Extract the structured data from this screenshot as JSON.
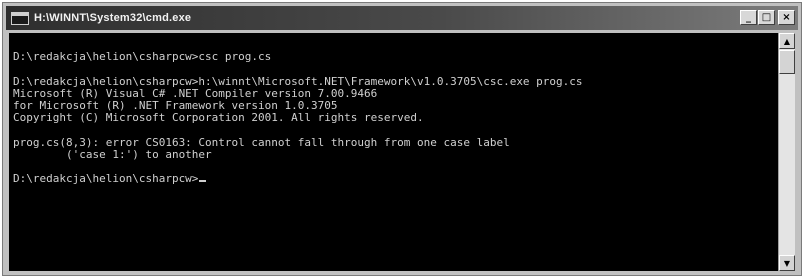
{
  "window": {
    "title": "H:\\WINNT\\System32\\cmd.exe",
    "icon": "console-window-icon",
    "buttons": {
      "minimize": "_",
      "maximize": "□",
      "close": "×"
    }
  },
  "console": {
    "lines": [
      "",
      "D:\\redakcja\\helion\\csharpcw>csc prog.cs",
      "",
      "D:\\redakcja\\helion\\csharpcw>h:\\winnt\\Microsoft.NET\\Framework\\v1.0.3705\\csc.exe prog.cs",
      "Microsoft (R) Visual C# .NET Compiler version 7.00.9466",
      "for Microsoft (R) .NET Framework version 1.0.3705",
      "Copyright (C) Microsoft Corporation 2001. All rights reserved.",
      "",
      "prog.cs(8,3): error CS0163: Control cannot fall through from one case label",
      "        ('case 1:') to another",
      "",
      "D:\\redakcja\\helion\\csharpcw>"
    ]
  },
  "scrollbar": {
    "up_arrow": "▲",
    "down_arrow": "▼"
  },
  "colors": {
    "console_background": "#000000",
    "console_text": "#d0d0d0",
    "title_bar": "#2e2e2e",
    "window_frame": "#c0c0c0"
  }
}
